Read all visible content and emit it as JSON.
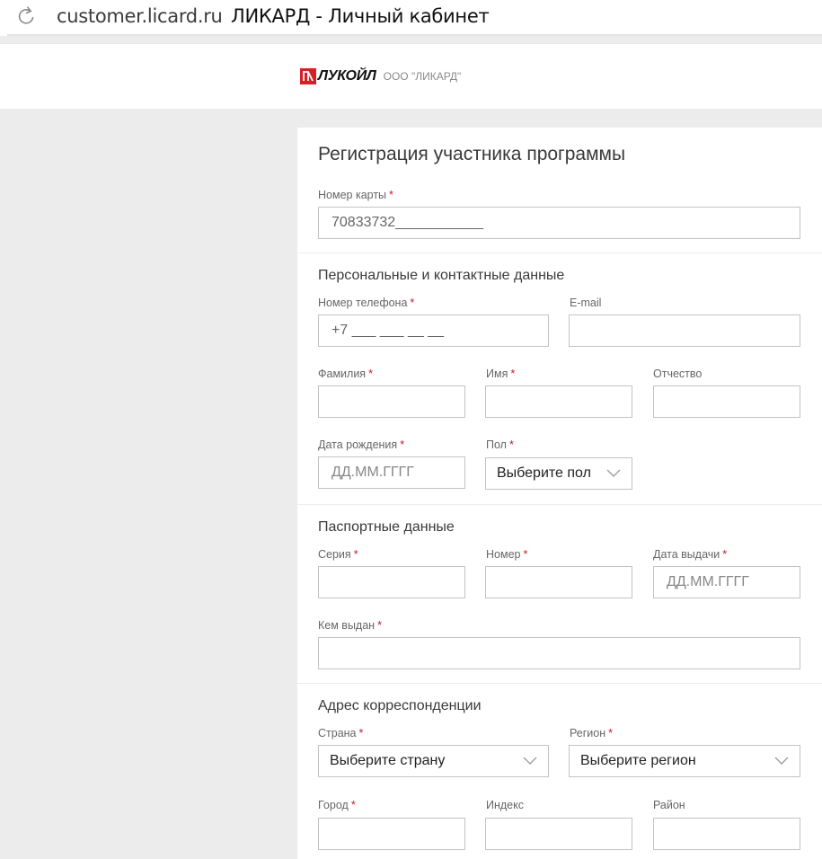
{
  "browser": {
    "url": "customer.licard.ru",
    "page_title": "ЛИКАРД - Личный кабинет",
    "reload_icon": "reload-icon"
  },
  "site_header": {
    "brand": "ЛУКОЙЛ",
    "company": "ООО \"ЛИКАРД\"",
    "brand_color": "#d61f26"
  },
  "form": {
    "title": "Регистрация участника программы",
    "card_number": {
      "label": "Номер карты",
      "value": "70833732___________"
    },
    "personal": {
      "title": "Персональные и контактные данные",
      "phone": {
        "label": "Номер телефона",
        "value": "+7 ___ ___ __ __"
      },
      "email": {
        "label": "E-mail",
        "value": ""
      },
      "last_name": {
        "label": "Фамилия",
        "value": ""
      },
      "first_name": {
        "label": "Имя",
        "value": ""
      },
      "middle_name": {
        "label": "Отчество",
        "value": ""
      },
      "birth_date": {
        "label": "Дата рождения",
        "placeholder": "ДД.ММ.ГГГГ"
      },
      "gender": {
        "label": "Пол",
        "selected": "Выберите пол"
      }
    },
    "passport": {
      "title": "Паспортные данные",
      "series": {
        "label": "Серия",
        "value": ""
      },
      "number": {
        "label": "Номер",
        "value": ""
      },
      "issue_date": {
        "label": "Дата выдачи",
        "placeholder": "ДД.ММ.ГГГГ"
      },
      "issued_by": {
        "label": "Кем выдан",
        "value": ""
      }
    },
    "address": {
      "title": "Адрес корреспонденции",
      "country": {
        "label": "Страна",
        "selected": "Выберите страну"
      },
      "region": {
        "label": "Регион",
        "selected": "Выберите регион"
      },
      "city": {
        "label": "Город",
        "value": ""
      },
      "postcode": {
        "label": "Индекс",
        "value": ""
      },
      "district": {
        "label": "Район",
        "value": ""
      }
    },
    "required_mark": "*",
    "colors": {
      "required": "#c61b25",
      "border": "#c3c3c3",
      "page_bg": "#ececec"
    }
  }
}
